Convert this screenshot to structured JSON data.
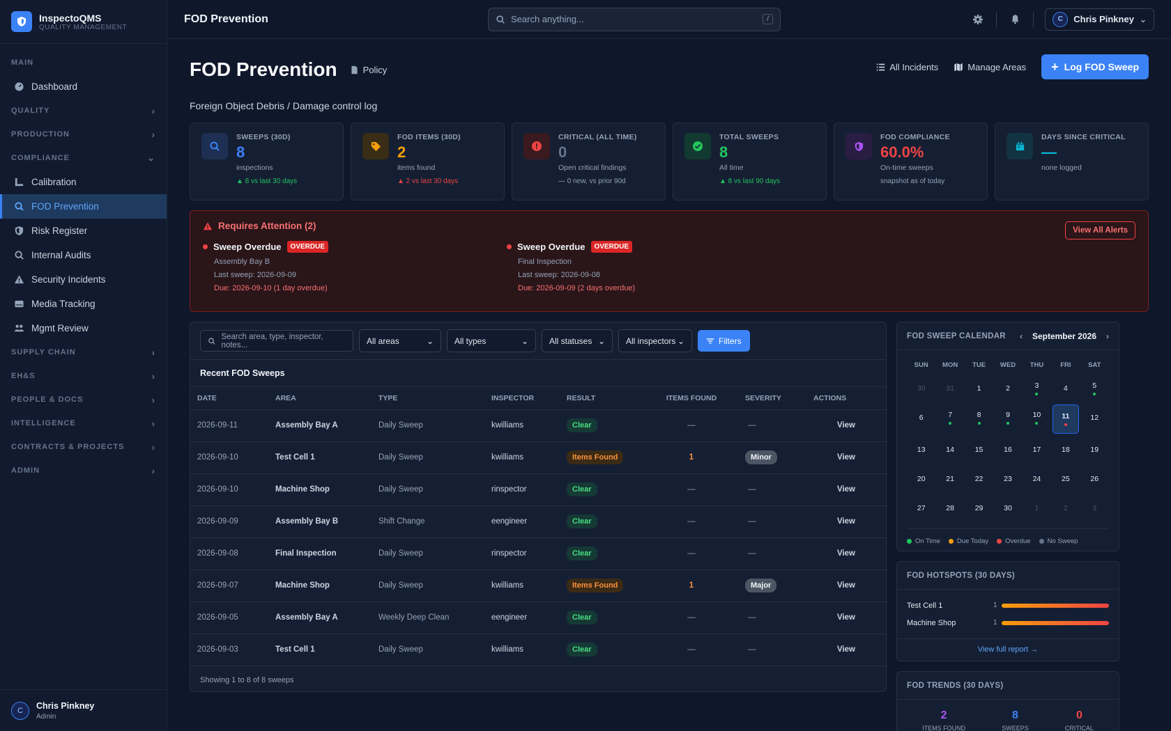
{
  "brand": {
    "name": "InspectoQMS",
    "sub": "QUALITY MANAGEMENT"
  },
  "nav": {
    "main_label": "MAIN",
    "dashboard": "Dashboard",
    "quality": "QUALITY",
    "production": "PRODUCTION",
    "compliance": "COMPLIANCE",
    "compliance_items": [
      "Calibration",
      "FOD Prevention",
      "Risk Register",
      "Internal Audits",
      "Security Incidents",
      "Media Tracking",
      "Mgmt Review"
    ],
    "supply_chain": "SUPPLY CHAIN",
    "ehs": "EH&S",
    "people_docs": "PEOPLE & DOCS",
    "intelligence": "INTELLIGENCE",
    "contracts": "CONTRACTS & PROJECTS",
    "admin": "ADMIN"
  },
  "side_user": {
    "initial": "C",
    "name": "Chris Pinkney",
    "role": "Admin"
  },
  "topbar": {
    "title": "FOD Prevention",
    "search_placeholder": "Search anything...",
    "kbd": "/",
    "user_initial": "C",
    "user_name": "Chris Pinkney"
  },
  "page": {
    "title": "FOD Prevention",
    "policy": "Policy",
    "subtitle": "Foreign Object Debris / Damage control log",
    "all_incidents": "All Incidents",
    "manage_areas": "Manage Areas",
    "log_sweep": "Log FOD Sweep"
  },
  "stats": [
    {
      "label": "SWEEPS (30D)",
      "value": "8",
      "sub": "inspections",
      "trend": "▲ 8 vs last 30 days",
      "color": "#3b82f6",
      "trend_color": "#22c55e",
      "icon": "search-icon"
    },
    {
      "label": "FOD ITEMS (30D)",
      "value": "2",
      "sub": "items found",
      "trend": "▲ 2 vs last 30 days",
      "color": "#f59e0b",
      "trend_color": "#ef4444",
      "icon": "tag-icon"
    },
    {
      "label": "CRITICAL (ALL TIME)",
      "value": "0",
      "sub": "Open critical findings",
      "trend": "— 0 new, vs prior 90d",
      "color": "#64748b",
      "trend_color": "#94a3b8",
      "icon": "alert-icon"
    },
    {
      "label": "TOTAL SWEEPS",
      "value": "8",
      "sub": "All time",
      "trend": "▲ 8 vs last 90 days",
      "color": "#22c55e",
      "trend_color": "#22c55e",
      "icon": "check-icon"
    },
    {
      "label": "FOD COMPLIANCE",
      "value": "60.0%",
      "sub": "On-time sweeps",
      "trend": "snapshot as of today",
      "color": "#ef4444",
      "trend_color": "#94a3b8",
      "icon": "shield-icon"
    },
    {
      "label": "DAYS SINCE CRITICAL",
      "value": "—",
      "sub": "none logged",
      "trend": "",
      "color": "#06b6d4",
      "trend_color": "#94a3b8",
      "icon": "calendar-icon"
    }
  ],
  "alerts": {
    "title": "Requires Attention (2)",
    "view_all": "View All Alerts",
    "items": [
      {
        "title": "Sweep Overdue",
        "badge": "OVERDUE",
        "area": "Assembly Bay B",
        "last": "Last sweep: 2026-09-09",
        "due": "Due: 2026-09-10 (1 day overdue)"
      },
      {
        "title": "Sweep Overdue",
        "badge": "OVERDUE",
        "area": "Final Inspection",
        "last": "Last sweep: 2026-09-08",
        "due": "Due: 2026-09-09 (2 days overdue)"
      }
    ]
  },
  "filters": {
    "search_placeholder": "Search area, type, inspector, notes...",
    "areas": "All areas",
    "types": "All types",
    "statuses": "All statuses",
    "inspectors": "All inspectors",
    "filters_btn": "Filters"
  },
  "table": {
    "title": "Recent FOD Sweeps",
    "headers": [
      "DATE",
      "AREA",
      "TYPE",
      "INSPECTOR",
      "RESULT",
      "ITEMS FOUND",
      "SEVERITY",
      "ACTIONS"
    ],
    "rows": [
      {
        "date": "2026-09-11",
        "area": "Assembly Bay A",
        "type": "Daily Sweep",
        "inspector": "kwilliams",
        "result": "Clear",
        "items": "—",
        "severity": "—",
        "action": "View"
      },
      {
        "date": "2026-09-10",
        "area": "Test Cell 1",
        "type": "Daily Sweep",
        "inspector": "kwilliams",
        "result": "Items Found",
        "items": "1",
        "severity": "Minor",
        "action": "View"
      },
      {
        "date": "2026-09-10",
        "area": "Machine Shop",
        "type": "Daily Sweep",
        "inspector": "rinspector",
        "result": "Clear",
        "items": "—",
        "severity": "—",
        "action": "View"
      },
      {
        "date": "2026-09-09",
        "area": "Assembly Bay B",
        "type": "Shift Change",
        "inspector": "eengineer",
        "result": "Clear",
        "items": "—",
        "severity": "—",
        "action": "View"
      },
      {
        "date": "2026-09-08",
        "area": "Final Inspection",
        "type": "Daily Sweep",
        "inspector": "rinspector",
        "result": "Clear",
        "items": "—",
        "severity": "—",
        "action": "View"
      },
      {
        "date": "2026-09-07",
        "area": "Machine Shop",
        "type": "Daily Sweep",
        "inspector": "kwilliams",
        "result": "Items Found",
        "items": "1",
        "severity": "Major",
        "action": "View"
      },
      {
        "date": "2026-09-05",
        "area": "Assembly Bay A",
        "type": "Weekly Deep Clean",
        "inspector": "eengineer",
        "result": "Clear",
        "items": "—",
        "severity": "—",
        "action": "View"
      },
      {
        "date": "2026-09-03",
        "area": "Test Cell 1",
        "type": "Daily Sweep",
        "inspector": "kwilliams",
        "result": "Clear",
        "items": "—",
        "severity": "—",
        "action": "View"
      }
    ],
    "footer": "Showing 1 to 8 of 8 sweeps"
  },
  "calendar": {
    "title": "FOD SWEEP CALENDAR",
    "month": "September 2026",
    "dow": [
      "SUN",
      "MON",
      "TUE",
      "WED",
      "THU",
      "FRI",
      "SAT"
    ],
    "days": [
      {
        "n": "30",
        "m": true,
        "s": ""
      },
      {
        "n": "31",
        "m": true,
        "s": ""
      },
      {
        "n": "1",
        "s": ""
      },
      {
        "n": "2",
        "s": ""
      },
      {
        "n": "3",
        "s": "on"
      },
      {
        "n": "4",
        "s": ""
      },
      {
        "n": "5",
        "s": "on"
      },
      {
        "n": "6",
        "s": ""
      },
      {
        "n": "7",
        "s": "on"
      },
      {
        "n": "8",
        "s": "on"
      },
      {
        "n": "9",
        "s": "on"
      },
      {
        "n": "10",
        "s": "on"
      },
      {
        "n": "11",
        "s": "over",
        "t": true
      },
      {
        "n": "12",
        "s": ""
      },
      {
        "n": "13",
        "s": ""
      },
      {
        "n": "14",
        "s": ""
      },
      {
        "n": "15",
        "s": ""
      },
      {
        "n": "16",
        "s": ""
      },
      {
        "n": "17",
        "s": ""
      },
      {
        "n": "18",
        "s": ""
      },
      {
        "n": "19",
        "s": ""
      },
      {
        "n": "20",
        "s": ""
      },
      {
        "n": "21",
        "s": ""
      },
      {
        "n": "22",
        "s": ""
      },
      {
        "n": "23",
        "s": ""
      },
      {
        "n": "24",
        "s": ""
      },
      {
        "n": "25",
        "s": ""
      },
      {
        "n": "26",
        "s": ""
      },
      {
        "n": "27",
        "s": ""
      },
      {
        "n": "28",
        "s": ""
      },
      {
        "n": "29",
        "s": ""
      },
      {
        "n": "30",
        "s": ""
      },
      {
        "n": "1",
        "m": true,
        "s": ""
      },
      {
        "n": "2",
        "m": true,
        "s": ""
      },
      {
        "n": "3",
        "m": true,
        "s": ""
      }
    ],
    "legend": [
      {
        "label": "On Time",
        "color": "#22c55e"
      },
      {
        "label": "Due Today",
        "color": "#f59e0b"
      },
      {
        "label": "Overdue",
        "color": "#ef4444"
      },
      {
        "label": "No Sweep",
        "color": "#64748b"
      }
    ]
  },
  "hotspots": {
    "title": "FOD HOTSPOTS (30 DAYS)",
    "items": [
      {
        "name": "Test Cell 1",
        "count": "1"
      },
      {
        "name": "Machine Shop",
        "count": "1"
      }
    ],
    "link": "View full report →"
  },
  "trends": {
    "title": "FOD TRENDS (30 DAYS)",
    "items": [
      {
        "value": "2",
        "label": "ITEMS FOUND",
        "color": "#a855f7"
      },
      {
        "value": "8",
        "label": "SWEEPS",
        "color": "#3b82f6"
      },
      {
        "value": "0",
        "label": "CRITICAL",
        "color": "#ef4444"
      }
    ]
  }
}
